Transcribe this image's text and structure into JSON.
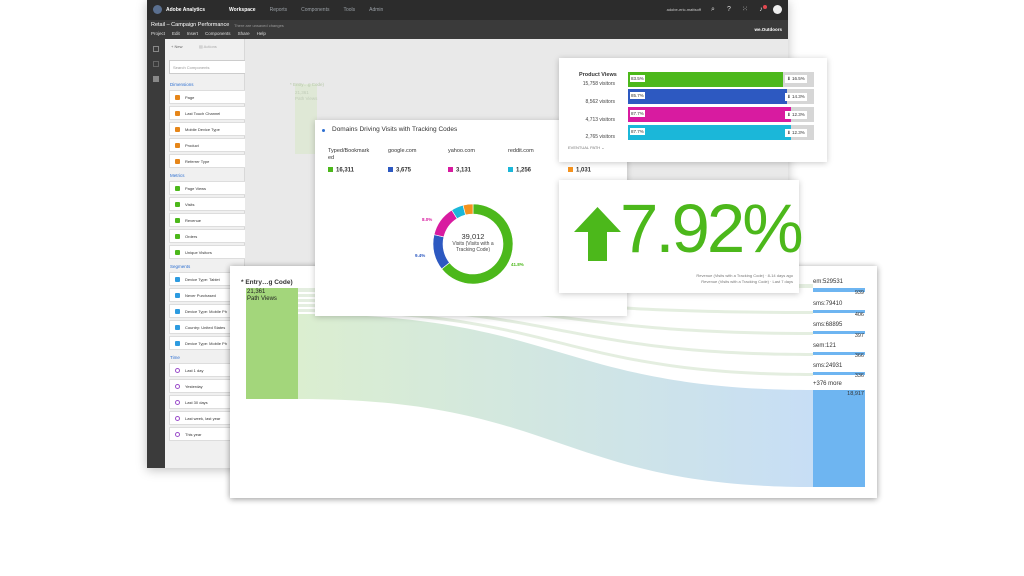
{
  "app": {
    "brand": "Adobe Analytics",
    "nav": [
      "Workspace",
      "Reports",
      "Components",
      "Tools",
      "Admin"
    ],
    "active_nav": "Workspace",
    "user": "adobe-eric-mattsoff",
    "project_title": "Retail – Campaign Performance",
    "unsaved": "There are unsaved changes",
    "menu": [
      "Project",
      "Edit",
      "Insert",
      "Components",
      "Share",
      "Help"
    ],
    "company": "we.Outdoors"
  },
  "left_panel": {
    "new_label": "New",
    "actions_label": "Actions",
    "search_placeholder": "Search Components",
    "dimensions_label": "Dimensions",
    "dimensions": [
      "Page",
      "Last Touch Channel",
      "Mobile Device Type",
      "Product",
      "Referrer Type"
    ],
    "metrics_label": "Metrics",
    "metrics": [
      "Page Views",
      "Visits",
      "Revenue",
      "Orders",
      "Unique Visitors"
    ],
    "segments_label": "Segments",
    "segments": [
      "Device Type: Tablet",
      "Never Purchased",
      "Device Type: Mobile Ph",
      "Country: United States",
      "Device Type: Mobile Ph"
    ],
    "time_label": "Time",
    "time": [
      "Last 1 day",
      "Yesterday",
      "Last 30 days",
      "Last week, last year",
      "This year"
    ]
  },
  "canvas_ghost": {
    "entry": "* Entry…g Code)",
    "value": "21,361",
    "label": "Path Views"
  },
  "domains_card": {
    "title": "Domains Driving Visits with Tracking Codes",
    "items": [
      {
        "label": "Typed/Bookmarked",
        "value": "16,311",
        "color": "#4cb81b"
      },
      {
        "label": "google.com",
        "value": "3,675",
        "color": "#2d59c1"
      },
      {
        "label": "yahoo.com",
        "value": "3,131",
        "color": "#d81ba0"
      },
      {
        "label": "reddit.com",
        "value": "1,256",
        "color": "#1bb7d9"
      },
      {
        "label": "",
        "value": "1,031",
        "color": "#f5921e"
      }
    ],
    "donut": {
      "total": "39,012",
      "caption": "Visits (Visits with a Tracking Code)",
      "slices": [
        {
          "label": "41.8%",
          "value": 41.8,
          "color": "#4cb81b"
        },
        {
          "label": "9.4%",
          "value": 9.4,
          "color": "#2d59c1"
        },
        {
          "label": "8.0%",
          "value": 8.0,
          "color": "#d81ba0"
        },
        {
          "label": "",
          "value": 3.2,
          "color": "#1bb7d9"
        },
        {
          "label": "",
          "value": 2.6,
          "color": "#f5921e"
        }
      ]
    }
  },
  "path_card": {
    "entry": "* Entry…g Code)",
    "value": "21,361",
    "value_label": "Path Views",
    "targets": [
      {
        "label": "em:529531",
        "value": "939"
      },
      {
        "label": "sms:79410",
        "value": "406"
      },
      {
        "label": "sms:68895",
        "value": "397"
      },
      {
        "label": "sem:121",
        "value": "366"
      },
      {
        "label": "sms:24931",
        "value": "336"
      },
      {
        "label": "+376 more",
        "value": "18,917"
      }
    ]
  },
  "product_views_card": {
    "title": "Product Views",
    "rows": [
      {
        "visitors": "15,758 visitors",
        "pct_label": "83.5%",
        "pct": 83.5,
        "delta": "16.5%",
        "color": "#4cb81b"
      },
      {
        "visitors": "8,562 visitors",
        "pct_label": "85.7%",
        "pct": 85.7,
        "delta": "14.3%",
        "color": "#2d59c1"
      },
      {
        "visitors": "4,713 visitors",
        "pct_label": "87.7%",
        "pct": 87.7,
        "delta": "12.3%",
        "color": "#d81ba0"
      },
      {
        "visitors": "2,765 visitors",
        "pct_label": "87.7%",
        "pct": 87.7,
        "delta": "12.3%",
        "color": "#1bb7d9"
      }
    ],
    "eventual_path": "EVENTUAL PATH"
  },
  "kpi_card": {
    "value": "7.92%",
    "direction": "up",
    "color": "#4cb81b",
    "foot_line1": "Revenue (Visits with a Tracking Code) · 8-14 days ago",
    "foot_line2": "Revenue (Visits with a Tracking Code) · Last 7 days"
  }
}
